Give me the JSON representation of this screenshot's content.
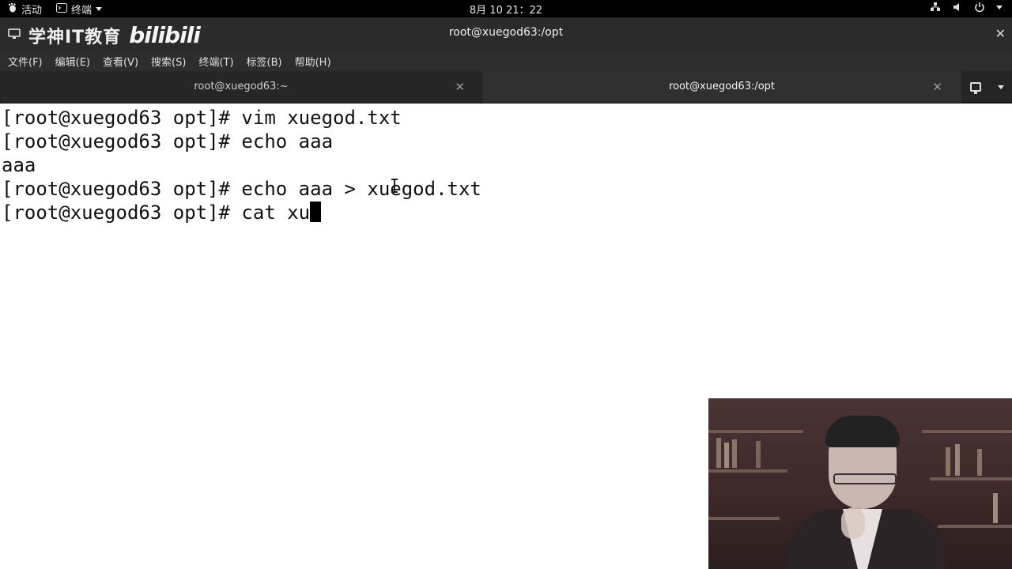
{
  "topbar": {
    "activities": "活动",
    "app_menu": "终端",
    "clock": "8月 10  21：22"
  },
  "window": {
    "title": "root@xuegod63:/opt",
    "watermark_cn": "学神IT教育",
    "watermark_bili": "bilibili",
    "close_glyph": "✕"
  },
  "menubar": {
    "items": [
      "文件(F)",
      "编辑(E)",
      "查看(V)",
      "搜索(S)",
      "终端(T)",
      "标签(B)",
      "帮助(H)"
    ]
  },
  "tabs": [
    {
      "label": "root@xuegod63:~",
      "close": "✕"
    },
    {
      "label": "root@xuegod63:/opt",
      "close": "✕"
    }
  ],
  "terminal": {
    "lines": [
      "[root@xuegod63 opt]# vim xuegod.txt",
      "[root@xuegod63 opt]# echo aaa",
      "aaa",
      "[root@xuegod63 opt]# echo aaa > xuegod.txt",
      "[root@xuegod63 opt]# cat xu"
    ]
  },
  "colors": {
    "terminal_bg": "#ffffff",
    "terminal_fg": "#101010",
    "chrome_bg": "#2b2b2b"
  },
  "icons": {
    "activities": "gnome-foot-icon",
    "terminal_app": "terminal-icon",
    "network": "network-icon",
    "volume": "volume-icon",
    "power": "power-icon",
    "new_tab": "new-tab-icon",
    "tab_menu": "chevron-down-icon"
  }
}
